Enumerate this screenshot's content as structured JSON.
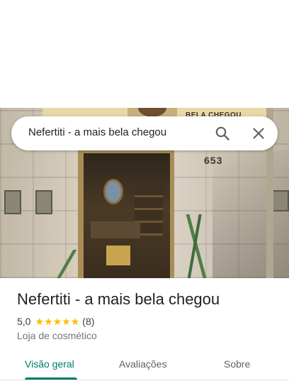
{
  "search": {
    "query": "Nefertiti - a mais bela chegou",
    "search_icon": "search-icon",
    "close_icon": "close-icon"
  },
  "photo": {
    "sign_text": "BELA CHEGOU",
    "house_number": "653"
  },
  "place": {
    "name": "Nefertiti - a mais bela chegou",
    "rating": "5,0",
    "stars": 5,
    "star_glyph": "★",
    "reviews": "(8)",
    "category": "Loja de cosmético"
  },
  "tabs": [
    {
      "label": "Visão geral",
      "active": true
    },
    {
      "label": "Avaliações",
      "active": false
    },
    {
      "label": "Sobre",
      "active": false
    }
  ],
  "colors": {
    "accent": "#00796b",
    "star": "#fbbc04"
  }
}
